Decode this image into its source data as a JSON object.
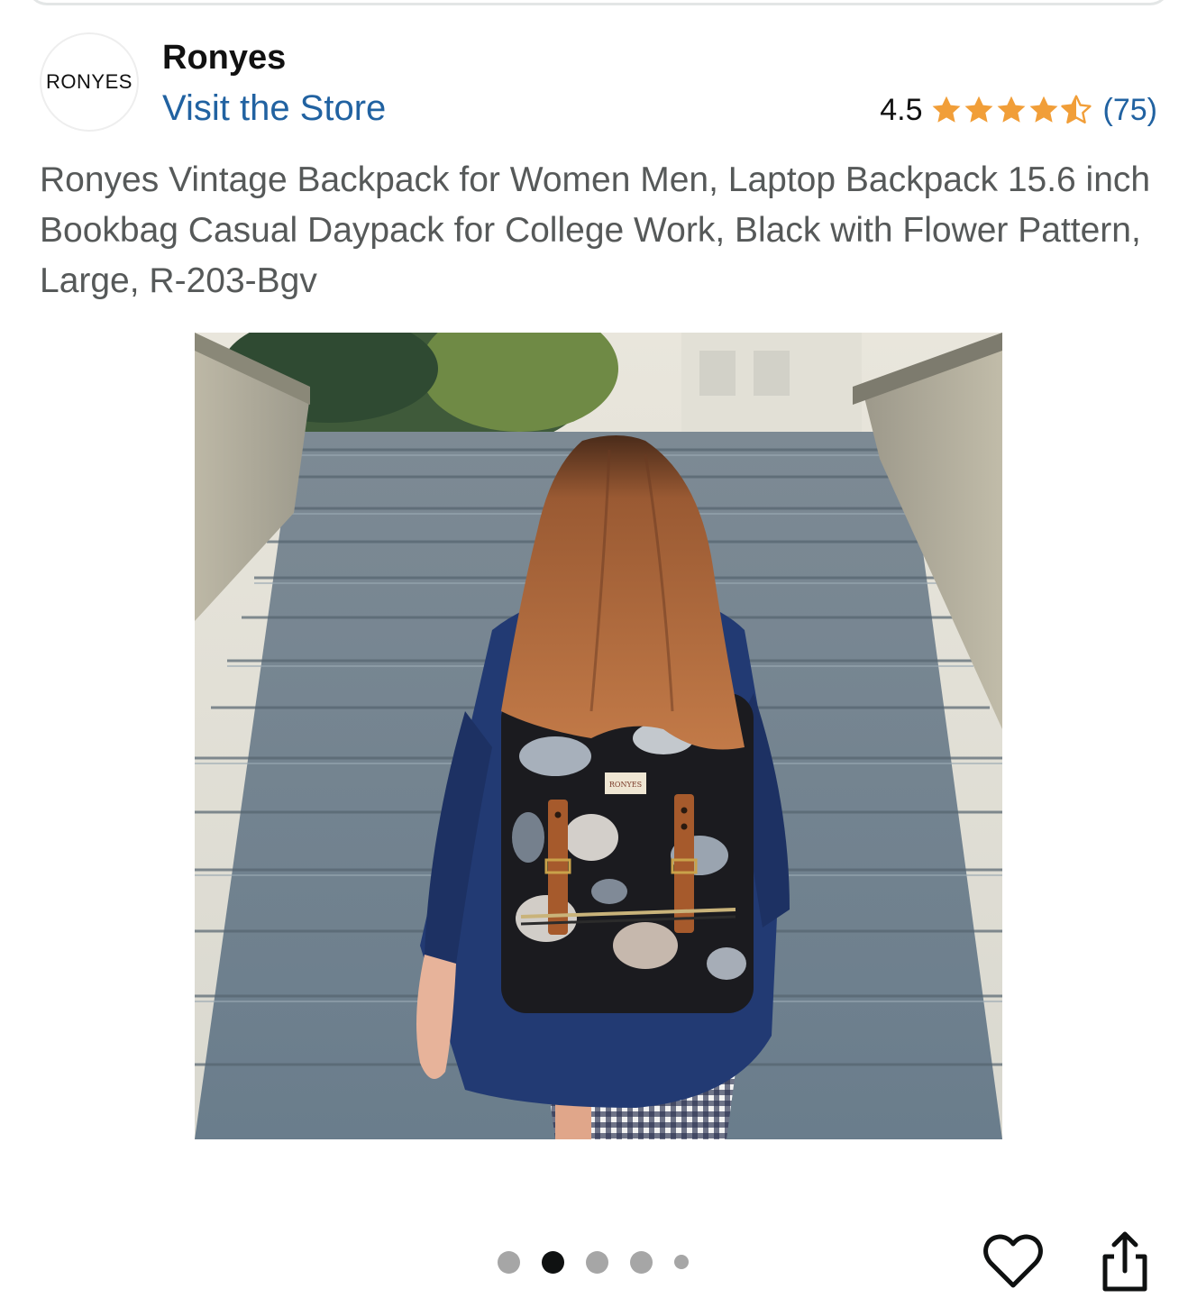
{
  "store": {
    "logo_text": "RONYES",
    "brand_name": "Ronyes",
    "visit_label": "Visit the Store"
  },
  "rating": {
    "value": "4.5",
    "stars": 4.5,
    "count": "(75)",
    "star_color": "#f19e38"
  },
  "product": {
    "title": "Ronyes Vintage Backpack for Women Men, Laptop Backpack 15.6 inch Bookbag Casual Daypack for College Work, Black with Flower Pattern, Large, R-203-Bgv",
    "image_description_icon": "product-photo",
    "bag_tag_text": "RONYES"
  },
  "carousel": {
    "total": 5,
    "active_index": 1
  },
  "actions": {
    "favorite_icon": "heart-outline-icon",
    "share_icon": "share-icon"
  },
  "colors": {
    "link": "#2162a1",
    "title_text": "#565959",
    "dot_inactive": "#a6a6a6",
    "dot_active": "#0f1111"
  }
}
